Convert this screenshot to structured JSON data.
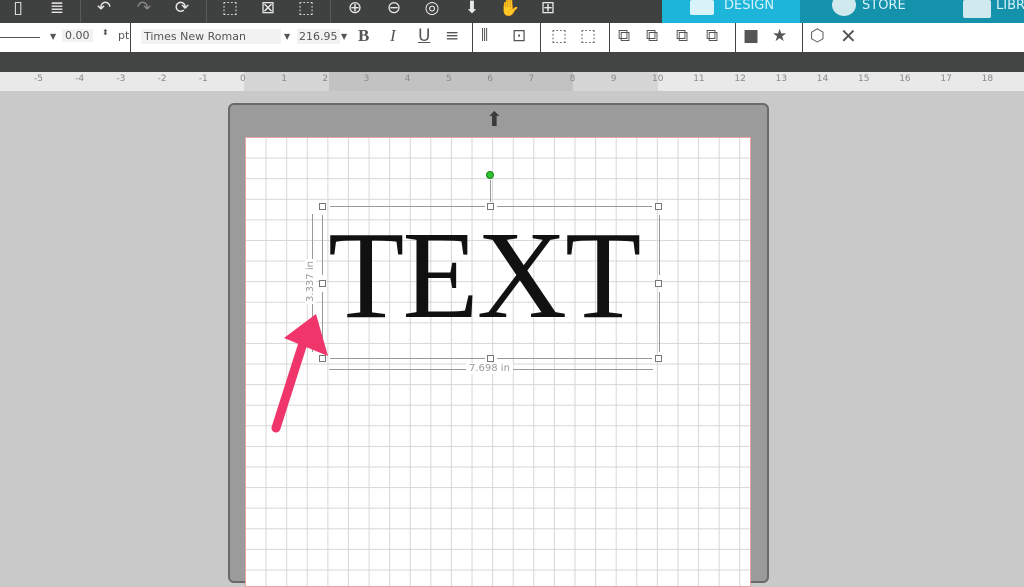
{
  "tabs": [
    {
      "label": "DESIGN",
      "active": true,
      "color": "#1db5da"
    },
    {
      "label": "STORE",
      "color": "#1592ab"
    },
    {
      "label": "LIBRARY",
      "color": "#1592ab"
    }
  ],
  "toolbar": {
    "line_width": "0.00",
    "line_unit": "pt",
    "font": "Times New Roman",
    "font_size": "216.95",
    "bold": "B",
    "italic": "I",
    "underline": "U"
  },
  "ruler": {
    "labels": [
      "-5",
      "-4",
      "-3",
      "-2",
      "-1",
      "0",
      "1",
      "2",
      "3",
      "4",
      "5",
      "6",
      "7",
      "8",
      "9",
      "10",
      "11",
      "12",
      "13",
      "14",
      "15",
      "16",
      "17",
      "18"
    ]
  },
  "canvas": {
    "text": "TEXT",
    "height_dim": "3.337 in",
    "width_dim": "7.698 in",
    "arrow_color": "#f0356a"
  }
}
